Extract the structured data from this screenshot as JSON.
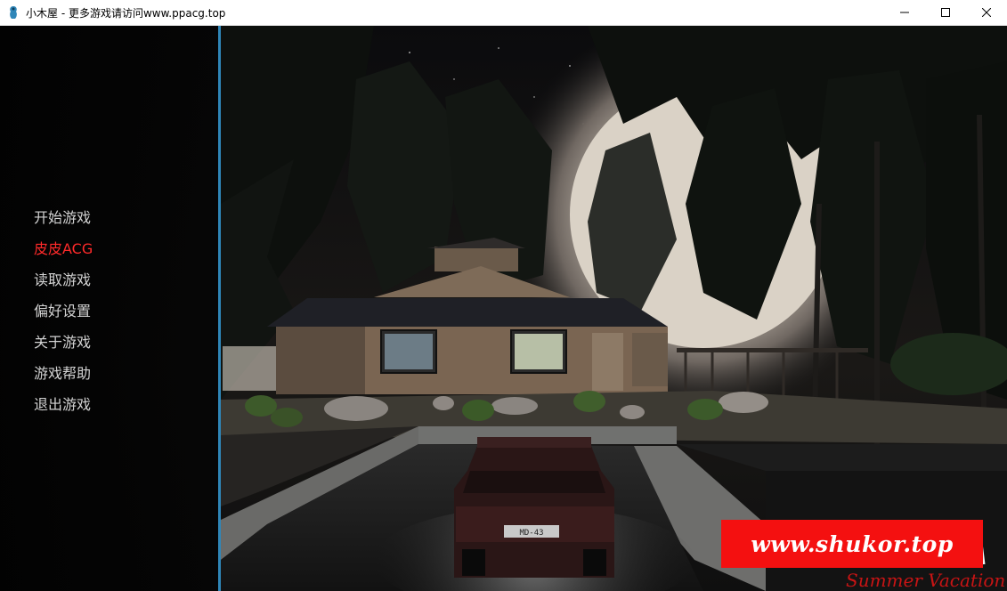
{
  "window": {
    "title": "小木屋 - 更多游戏请访问www.ppacg.top",
    "icons": {
      "app": "app-icon",
      "minimize": "minimize-icon",
      "maximize": "maximize-icon",
      "close": "close-icon"
    }
  },
  "menu": {
    "items": [
      {
        "label": "开始游戏",
        "active": false
      },
      {
        "label": "皮皮ACG",
        "active": true
      },
      {
        "label": "读取游戏",
        "active": false
      },
      {
        "label": "偏好设置",
        "active": false
      },
      {
        "label": "关于游戏",
        "active": false
      },
      {
        "label": "游戏帮助",
        "active": false
      },
      {
        "label": "退出游戏",
        "active": false
      }
    ],
    "colors": {
      "normal": "#d2d2d2",
      "active": "#ff2a2a",
      "divider": "#2f86b8"
    }
  },
  "scene": {
    "license_plate": "MD-43",
    "logo_script_text": "Summer Vacation"
  },
  "watermark": {
    "text": "www.shukor.top",
    "background": "#f41010"
  }
}
